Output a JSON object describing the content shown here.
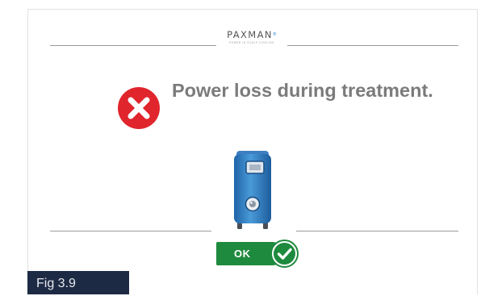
{
  "logo": {
    "name": "PAXMAN",
    "registered_mark": "®",
    "tagline": "POWER IN SCALP COOLING"
  },
  "dialog": {
    "icon": "error-x-icon",
    "message": "Power loss during treatment."
  },
  "device": {
    "icon": "paxman-cooling-unit-icon"
  },
  "actions": {
    "ok_label": "OK",
    "ok_icon": "checkmark-icon"
  },
  "figure": {
    "caption": "Fig 3.9"
  },
  "colors": {
    "error_red": "#e0252d",
    "confirm_green": "#1e8a3e",
    "device_blue": "#2f7fc4",
    "caption_bg": "#1d2a44",
    "message_gray": "#7b7b7b"
  }
}
